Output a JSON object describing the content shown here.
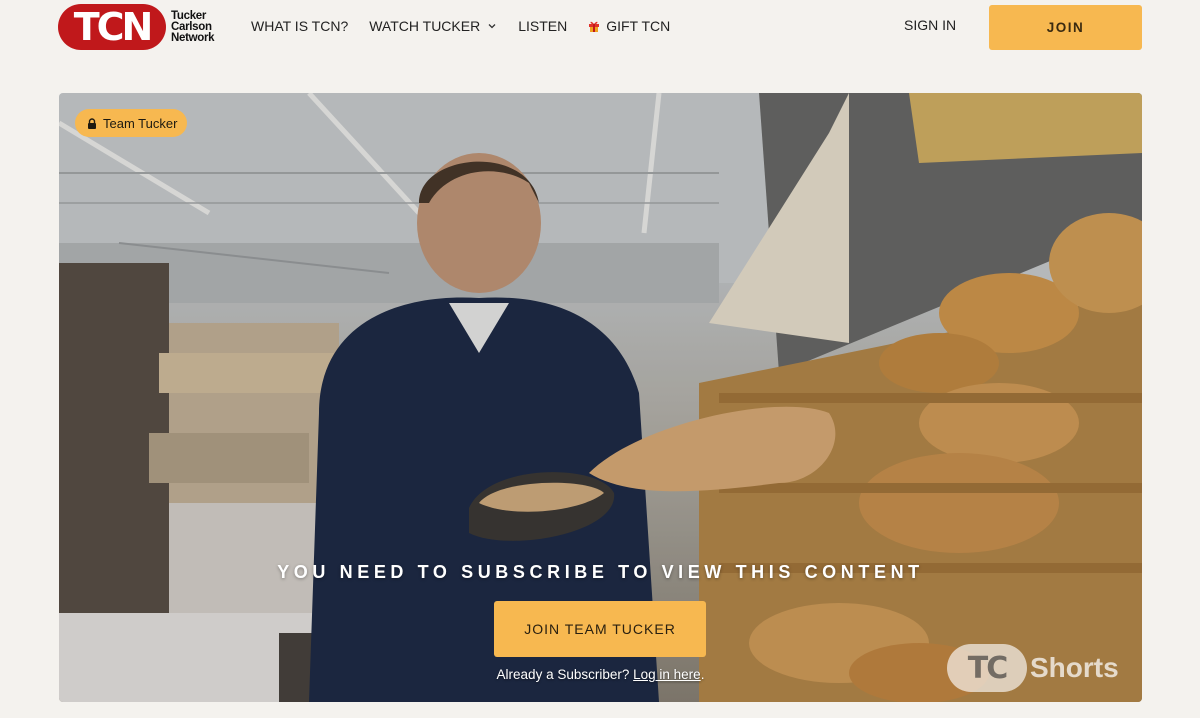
{
  "header": {
    "logo_mark": "TCN",
    "logo_lines": [
      "Tucker",
      "Carlson",
      "Network"
    ],
    "nav": [
      {
        "label": "WHAT IS TCN?",
        "icon": null
      },
      {
        "label": "WATCH TUCKER",
        "icon": "chevron-down-icon"
      },
      {
        "label": "LISTEN",
        "icon": null
      },
      {
        "label": "GIFT TCN",
        "icon": "gift-icon"
      }
    ],
    "sign_in": "SIGN IN",
    "join": "JOIN"
  },
  "hero": {
    "badge": "Team Tucker",
    "paywall_message": "YOU NEED TO SUBSCRIBE TO VIEW THIS CONTENT",
    "cta": "JOIN TEAM TUCKER",
    "subscriber_prefix": "Already a Subscriber? ",
    "login_link": "Log in here",
    "subscriber_suffix": ".",
    "watermark_mark": "TC",
    "watermark_text": "Shorts"
  },
  "colors": {
    "brand_red": "#c0181b",
    "accent": "#f7b850",
    "page_bg": "#f4f2ee"
  }
}
